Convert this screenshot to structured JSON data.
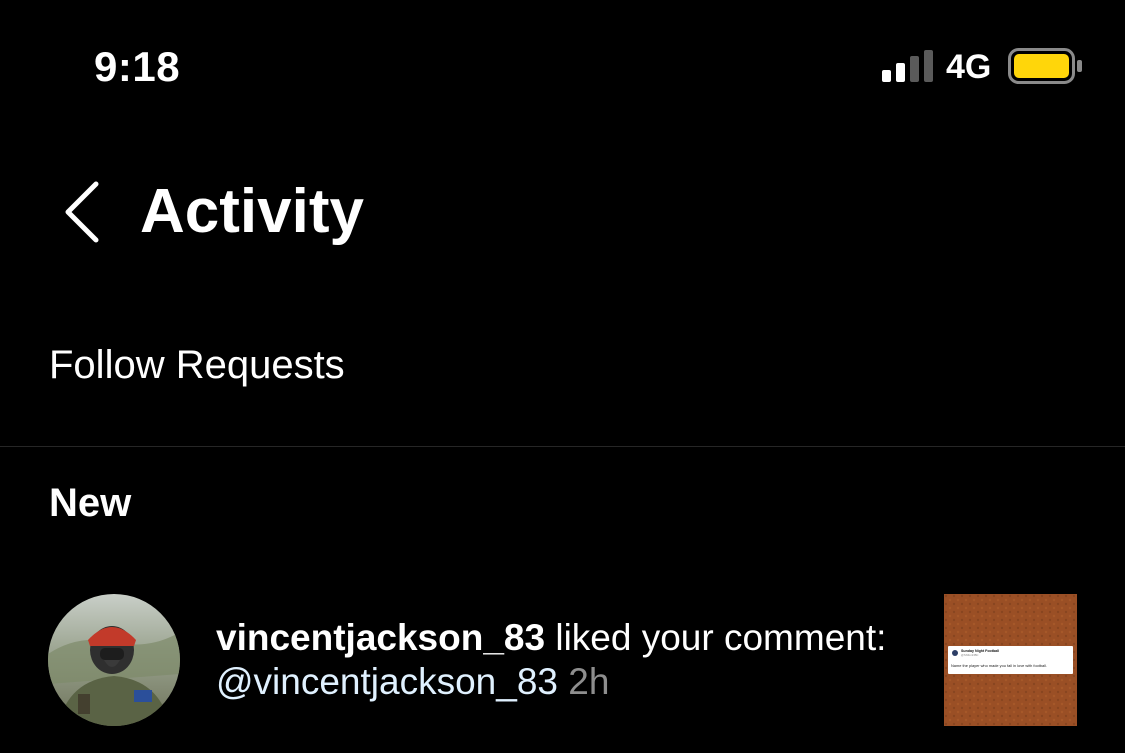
{
  "status_bar": {
    "time": "9:18",
    "network": "4G",
    "battery_color": "#FFD60A"
  },
  "header": {
    "title": "Activity",
    "back_icon": "chevron-left-icon"
  },
  "follow_requests": {
    "label": "Follow Requests"
  },
  "sections": {
    "new_title": "New"
  },
  "activity": {
    "username": "vincentjackson_83",
    "action_text": " liked your comment:",
    "mention": "@vincentjackson_83",
    "timestamp": "2h"
  },
  "thumbnail": {
    "card_title": "Sunday Night Football",
    "card_handle": "@SNFonNBC",
    "card_text": "Name the player who made you fall in love with football."
  },
  "colors": {
    "background": "#000000",
    "text": "#FFFFFF",
    "secondary_text": "#8E8E8E",
    "mention": "#E0F1FF",
    "divider": "#262626"
  }
}
